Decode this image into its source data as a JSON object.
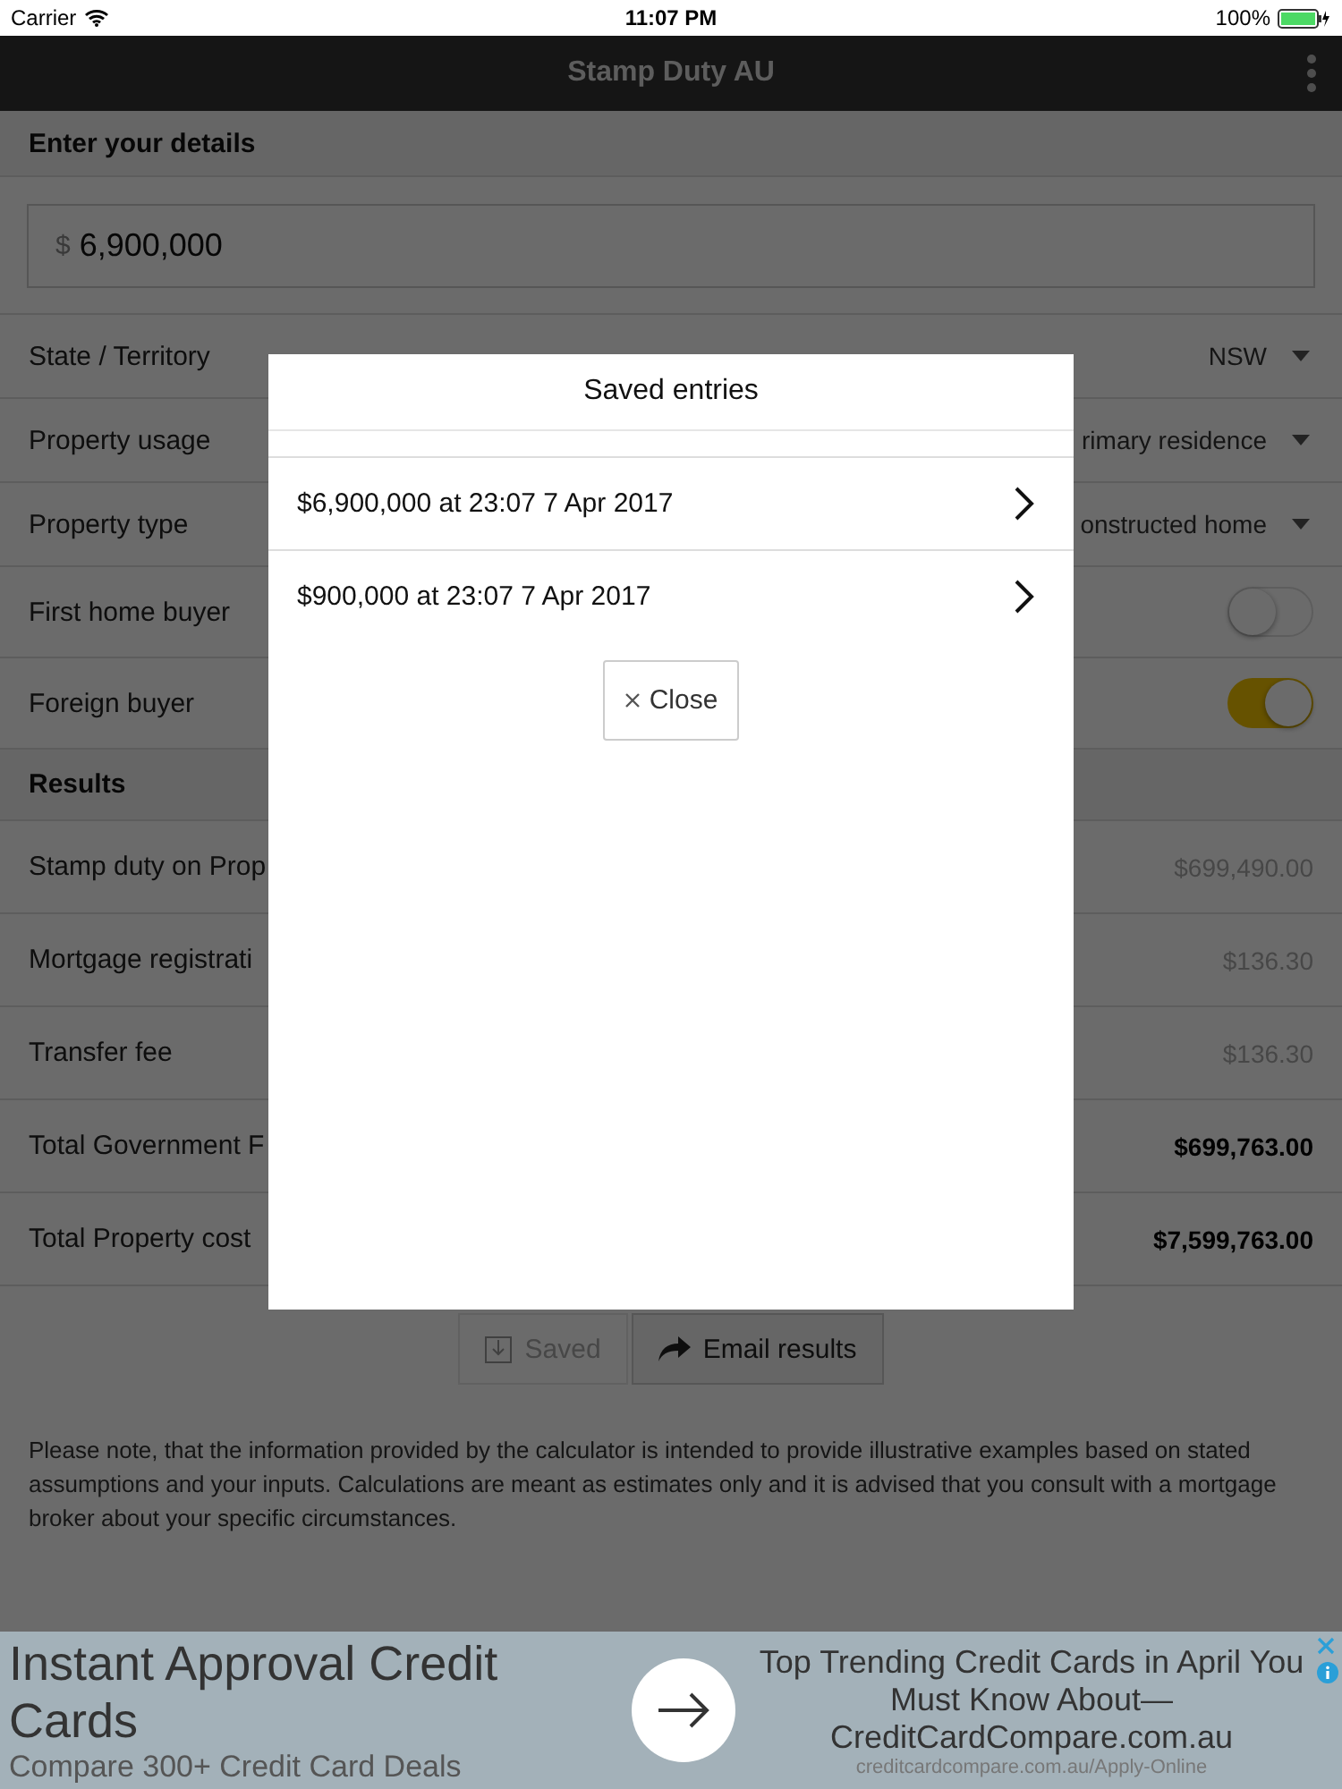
{
  "status_bar": {
    "carrier": "Carrier",
    "time": "11:07 PM",
    "battery": "100%"
  },
  "nav": {
    "title": "Stamp Duty AU"
  },
  "details": {
    "heading": "Enter your details",
    "amount": {
      "currency": "$",
      "value": "6,900,000"
    },
    "fields": [
      {
        "kind": "select",
        "label": "State / Territory",
        "value": "NSW"
      },
      {
        "kind": "select",
        "label": "Property usage",
        "value": "rimary residence"
      },
      {
        "kind": "select",
        "label": "Property type",
        "value": "onstructed home"
      },
      {
        "kind": "toggle",
        "label": "First home buyer",
        "on": false
      },
      {
        "kind": "toggle",
        "label": "Foreign buyer",
        "on": true
      }
    ]
  },
  "results": {
    "heading": "Results",
    "rows": [
      {
        "kind": "line",
        "label": "Stamp duty on Prop",
        "value": "$699,490.00"
      },
      {
        "kind": "line",
        "label": "Mortgage registrati",
        "value": "$136.30"
      },
      {
        "kind": "line",
        "label": "Transfer fee",
        "value": "$136.30"
      },
      {
        "kind": "total",
        "label": "Total Government F",
        "value": "$699,763.00"
      },
      {
        "kind": "total",
        "label": "Total Property cost",
        "value": "$7,599,763.00"
      }
    ]
  },
  "buttons": [
    {
      "kind": "save",
      "label": "Saved",
      "disabled": true
    },
    {
      "kind": "share",
      "label": "Email results",
      "disabled": false
    }
  ],
  "note": "Please note, that the information provided by the calculator is intended to provide illustrative examples based on stated assumptions and your inputs. Calculations are meant as estimates only and it is advised that you consult with a mortgage broker about your specific circumstances.",
  "ad": {
    "headline": "Instant Approval Credit Cards",
    "subline": "Compare 300+ Credit Card Deals",
    "title": "Top Trending Credit Cards in April You Must Know About—CreditCardCompare.com.au",
    "url": "creditcardcompare.com.au/Apply-Online"
  },
  "modal": {
    "title": "Saved entries",
    "entries": [
      {
        "label": "$6,900,000 at 23:07 7 Apr 2017"
      },
      {
        "label": "$900,000 at 23:07 7 Apr 2017"
      }
    ],
    "close": "Close"
  }
}
